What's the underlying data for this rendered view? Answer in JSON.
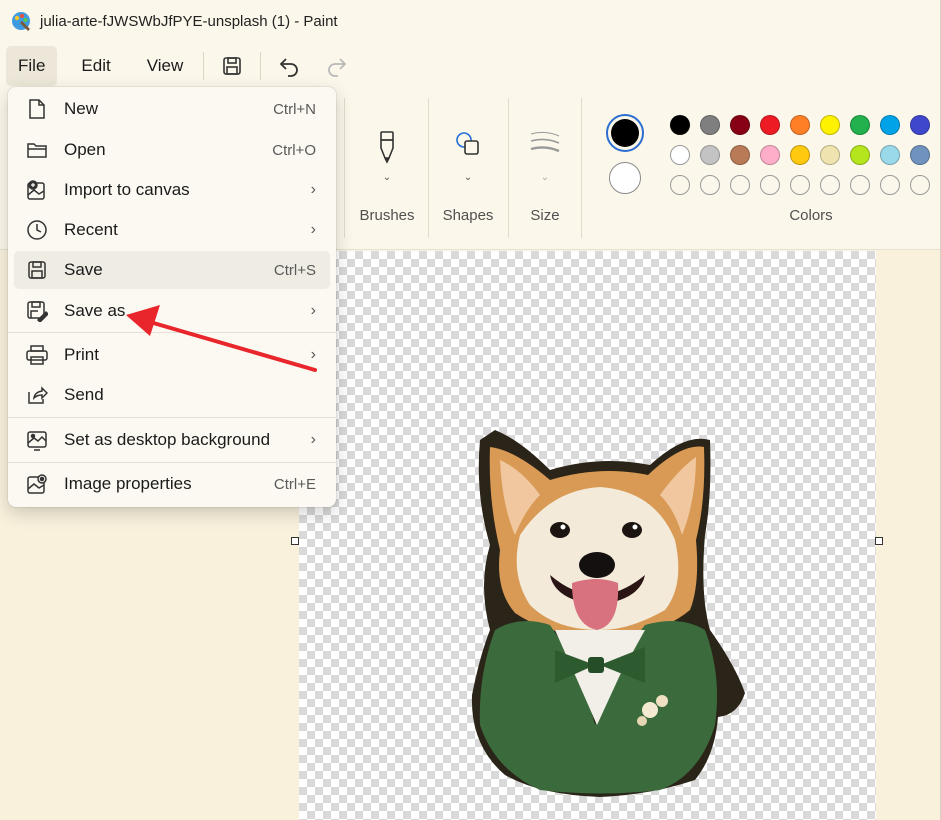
{
  "window": {
    "title": "julia-arte-fJWSWbJfPYE-unsplash (1) - Paint"
  },
  "menubar": {
    "file": "File",
    "edit": "Edit",
    "view": "View"
  },
  "ribbon": {
    "brushes_label": "Brushes",
    "shapes_label": "Shapes",
    "size_label": "Size",
    "colors_label": "Colors",
    "primary_color": "#000000",
    "secondary_color": "#ffffff",
    "palette_row1": [
      "#000000",
      "#7f7f7f",
      "#880015",
      "#ed1c24",
      "#ff7f27",
      "#fff200",
      "#22b14c",
      "#00a2e8",
      "#3f48cc"
    ],
    "palette_row2": [
      "#ffffff",
      "#c3c3c3",
      "#b97a57",
      "#ffaec9",
      "#ffc90e",
      "#efe4b0",
      "#b5e61d",
      "#99d9ea",
      "#7092be"
    ]
  },
  "file_menu": {
    "items": [
      {
        "label": "New",
        "shortcut": "Ctrl+N",
        "icon": "new-file-icon"
      },
      {
        "label": "Open",
        "shortcut": "Ctrl+O",
        "icon": "folder-icon"
      },
      {
        "label": "Import to canvas",
        "shortcut": "",
        "icon": "import-image-icon",
        "submenu": true
      },
      {
        "label": "Recent",
        "shortcut": "",
        "icon": "clock-icon",
        "submenu": true
      },
      {
        "label": "Save",
        "shortcut": "Ctrl+S",
        "icon": "save-icon"
      },
      {
        "label": "Save as",
        "shortcut": "",
        "icon": "save-as-icon",
        "submenu": true
      },
      {
        "label": "Print",
        "shortcut": "",
        "icon": "printer-icon",
        "submenu": true
      },
      {
        "label": "Send",
        "shortcut": "",
        "icon": "share-icon"
      },
      {
        "label": "Set as desktop background",
        "shortcut": "",
        "icon": "desktop-background-icon",
        "submenu": true
      },
      {
        "label": "Image properties",
        "shortcut": "Ctrl+E",
        "icon": "image-properties-icon"
      }
    ],
    "submenu_arrow": "›"
  },
  "annotation": {
    "arrow_color": "#e8262b"
  }
}
